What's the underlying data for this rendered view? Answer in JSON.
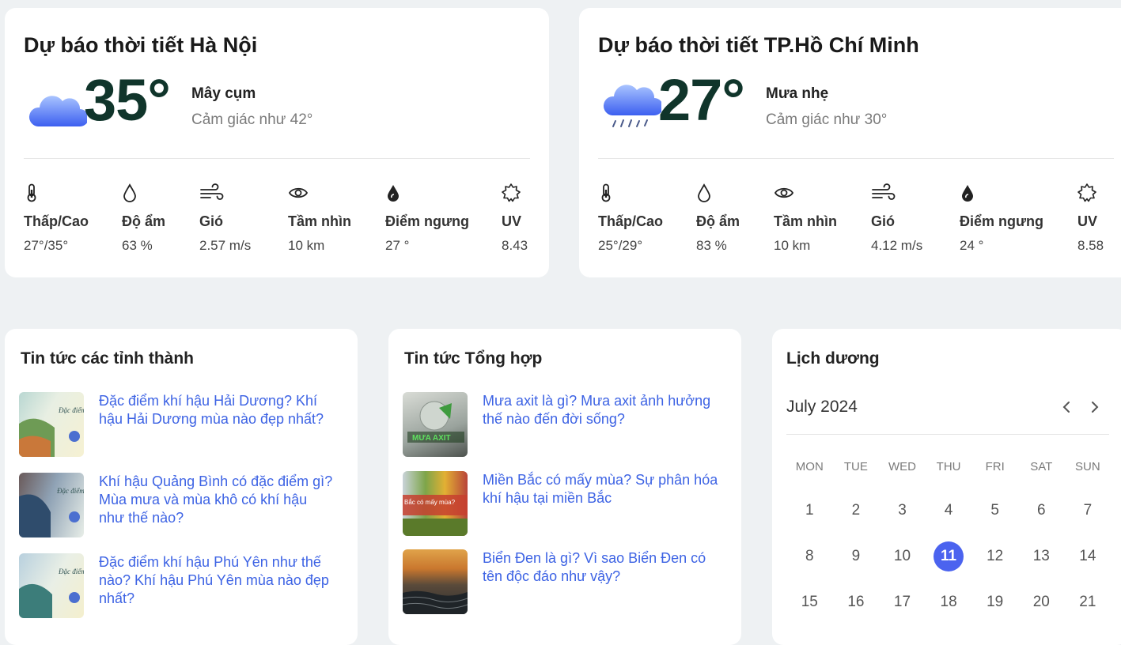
{
  "weather": [
    {
      "title": "Dự báo thời tiết Hà Nội",
      "icon": "cloud-icon",
      "temp": "35°",
      "condition": "Mây cụm",
      "feels_like": "Cảm giác như 42°",
      "stats": [
        {
          "icon": "thermometer-icon",
          "label": "Thấp/Cao",
          "value": "27°/35°"
        },
        {
          "icon": "humidity-icon",
          "label": "Độ ẩm",
          "value": "63 %"
        },
        {
          "icon": "wind-icon",
          "label": "Gió",
          "value": "2.57 m/s"
        },
        {
          "icon": "eye-icon",
          "label": "Tầm nhìn",
          "value": "10 km"
        },
        {
          "icon": "dew-point-icon",
          "label": "Điểm ngưng",
          "value": "27 °"
        },
        {
          "icon": "sun-icon",
          "label": "UV",
          "value": "8.43"
        }
      ]
    },
    {
      "title": "Dự báo thời tiết TP.Hồ Chí Minh",
      "icon": "rain-cloud-icon",
      "temp": "27°",
      "condition": "Mưa nhẹ",
      "feels_like": "Cảm giác như 30°",
      "stats": [
        {
          "icon": "thermometer-icon",
          "label": "Thấp/Cao",
          "value": "25°/29°"
        },
        {
          "icon": "humidity-icon",
          "label": "Độ ẩm",
          "value": "83 %"
        },
        {
          "icon": "eye-icon",
          "label": "Tầm nhìn",
          "value": "10 km"
        },
        {
          "icon": "wind-icon",
          "label": "Gió",
          "value": "4.12 m/s"
        },
        {
          "icon": "dew-point-icon",
          "label": "Điểm ngưng",
          "value": "24 °"
        },
        {
          "icon": "sun-icon",
          "label": "UV",
          "value": "8.58"
        }
      ]
    }
  ],
  "news_provinces": {
    "title": "Tin tức các tỉnh thành",
    "items": [
      {
        "title": "Đặc điểm khí hậu Hải Dương? Khí hậu Hải Dương mùa nào đẹp nhất?",
        "thumb_text": "Đặc điểm HẢI DƯ"
      },
      {
        "title": "Khí hậu Quảng Bình có đặc điểm gì? Mùa mưa và mùa khô có khí hậu như thế nào?",
        "thumb_text": "Đặc điểm QUẢNG"
      },
      {
        "title": "Đặc điểm khí hậu Phú Yên như thế nào? Khí hậu Phú Yên mùa nào đẹp nhất?",
        "thumb_text": "Đặc điểm PHÚ"
      }
    ]
  },
  "news_general": {
    "title": "Tin tức Tổng hợp",
    "items": [
      {
        "title": "Mưa axit là gì? Mưa axit ảnh hưởng thế nào đến đời sống?",
        "thumb_text": "MƯA AXIT"
      },
      {
        "title": "Miền Bắc có mấy mùa? Sự phân hóa khí hậu tại miền Bắc",
        "thumb_text": "Bắc có mấy mùa?"
      },
      {
        "title": "Biển Đen là gì? Vì sao Biển Đen có tên độc đáo như vậy?",
        "thumb_text": ""
      }
    ]
  },
  "calendar": {
    "title": "Lịch dương",
    "month": "July 2024",
    "weekdays": [
      "MON",
      "TUE",
      "WED",
      "THU",
      "FRI",
      "SAT",
      "SUN"
    ],
    "days": [
      "1",
      "2",
      "3",
      "4",
      "5",
      "6",
      "7",
      "8",
      "9",
      "10",
      "11",
      "12",
      "13",
      "14",
      "15",
      "16",
      "17",
      "18",
      "19",
      "20",
      "21"
    ],
    "today": "11",
    "accent": "#4b63ef"
  },
  "colors": {
    "link": "#3d63e4",
    "temp": "#10352b",
    "background": "#eef1f3"
  }
}
